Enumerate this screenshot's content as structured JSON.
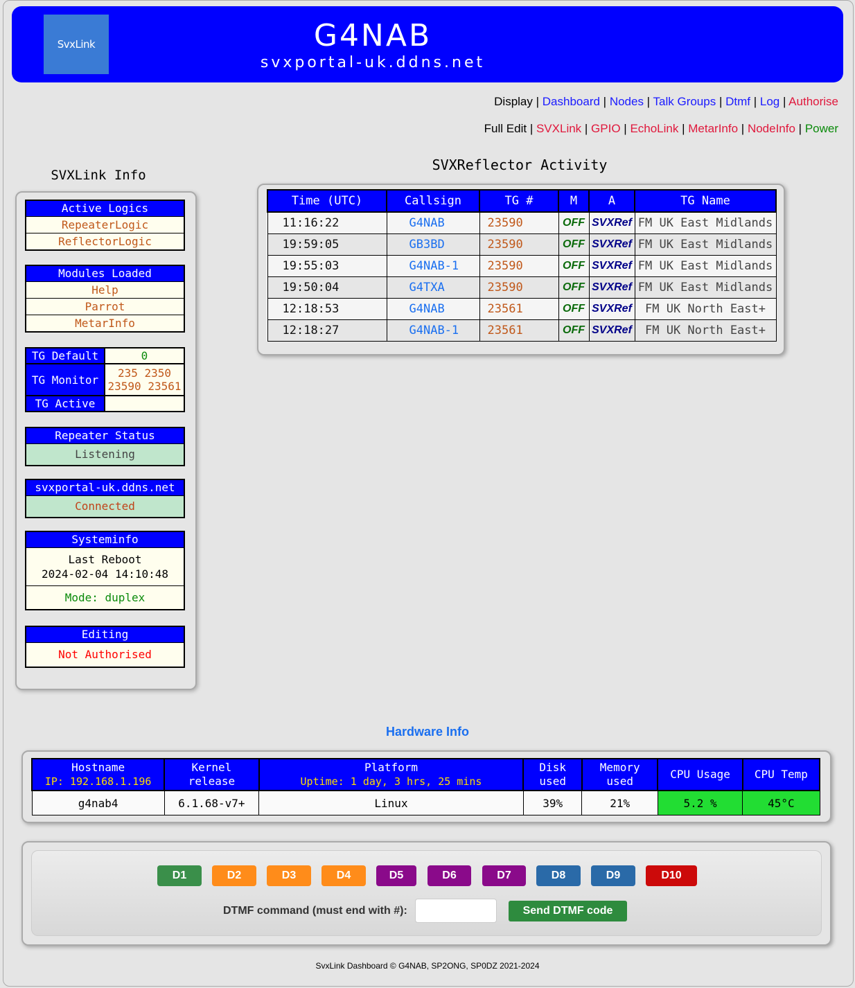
{
  "header": {
    "logo_text": "SvxLink",
    "callsign": "G4NAB",
    "host": "svxportal-uk.ddns.net"
  },
  "nav": {
    "display": {
      "label": "Display",
      "links": [
        "Dashboard",
        "Nodes",
        "Talk Groups",
        "Dtmf",
        "Log",
        "Authorise"
      ]
    },
    "full_edit": {
      "label": "Full Edit",
      "links": [
        "SVXLink",
        "GPIO",
        "EchoLink",
        "MetarInfo",
        "NodeInfo",
        "Power"
      ]
    }
  },
  "sidebar": {
    "title": "SVXLink Info",
    "active_logics": {
      "header": "Active Logics",
      "items": [
        "RepeaterLogic",
        "ReflectorLogic"
      ]
    },
    "modules": {
      "header": "Modules Loaded",
      "items": [
        "Help",
        "Parrot",
        "MetarInfo"
      ]
    },
    "tg": {
      "default_label": "TG Default",
      "default_value": "0",
      "monitor_label": "TG Monitor",
      "monitor_line1": "235 2350",
      "monitor_line2": "23590 23561",
      "active_label": "TG Active",
      "active_value": ""
    },
    "repeater_status": {
      "header": "Repeater Status",
      "value": "Listening"
    },
    "reflector": {
      "header": "svxportal-uk.ddns.net",
      "value": "Connected"
    },
    "systeminfo": {
      "header": "Systeminfo",
      "reboot_label": "Last Reboot",
      "reboot_time": "2024-02-04 14:10:48",
      "mode": "Mode: duplex"
    },
    "editing": {
      "header": "Editing",
      "value": "Not Authorised"
    }
  },
  "activity": {
    "title": "SVXReflector Activity",
    "columns": [
      "Time (UTC)",
      "Callsign",
      "TG #",
      "M",
      "A",
      "TG Name"
    ],
    "rows": [
      [
        "11:16:22",
        "G4NAB",
        "23590",
        "OFF",
        "SVXRef",
        "FM UK East Midlands"
      ],
      [
        "19:59:05",
        "GB3BD",
        "23590",
        "OFF",
        "SVXRef",
        "FM UK East Midlands"
      ],
      [
        "19:55:03",
        "G4NAB-1",
        "23590",
        "OFF",
        "SVXRef",
        "FM UK East Midlands"
      ],
      [
        "19:50:04",
        "G4TXA",
        "23590",
        "OFF",
        "SVXRef",
        "FM UK East Midlands"
      ],
      [
        "12:18:53",
        "G4NAB",
        "23561",
        "OFF",
        "SVXRef",
        "FM UK North East+"
      ],
      [
        "12:18:27",
        "G4NAB-1",
        "23561",
        "OFF",
        "SVXRef",
        "FM UK North East+"
      ]
    ]
  },
  "hardware": {
    "title": "Hardware Info",
    "headers": {
      "hostname": "Hostname",
      "ip": "IP: 192.168.1.196",
      "kernel1": "Kernel",
      "kernel2": "release",
      "platform": "Platform",
      "uptime": "Uptime: 1 day, 3 hrs, 25 mins",
      "disk1": "Disk",
      "disk2": "used",
      "mem1": "Memory",
      "mem2": "used",
      "cpu_usage": "CPU Usage",
      "cpu_temp": "CPU Temp"
    },
    "values": {
      "hostname": "g4nab4",
      "kernel": "6.1.68-v7+",
      "platform": "Linux",
      "disk": "39%",
      "memory": "21%",
      "cpu_usage": "5.2 %",
      "cpu_temp": "45°C"
    }
  },
  "dtmf": {
    "buttons": [
      {
        "label": "D1",
        "color": "#3a8f4a"
      },
      {
        "label": "D2",
        "color": "#ff8c1a"
      },
      {
        "label": "D3",
        "color": "#ff8c1a"
      },
      {
        "label": "D4",
        "color": "#ff8c1a"
      },
      {
        "label": "D5",
        "color": "#8a0a8a"
      },
      {
        "label": "D6",
        "color": "#8a0a8a"
      },
      {
        "label": "D7",
        "color": "#8a0a8a"
      },
      {
        "label": "D8",
        "color": "#2a6aa8"
      },
      {
        "label": "D9",
        "color": "#2a6aa8"
      },
      {
        "label": "D10",
        "color": "#cc0a0a"
      }
    ],
    "input_label": "DTMF command (must end with #):",
    "input_value": "",
    "send_label": "Send DTMF code"
  },
  "footer": "SvxLink Dashboard © G4NAB, SP2ONG, SP0DZ 2021-2024"
}
